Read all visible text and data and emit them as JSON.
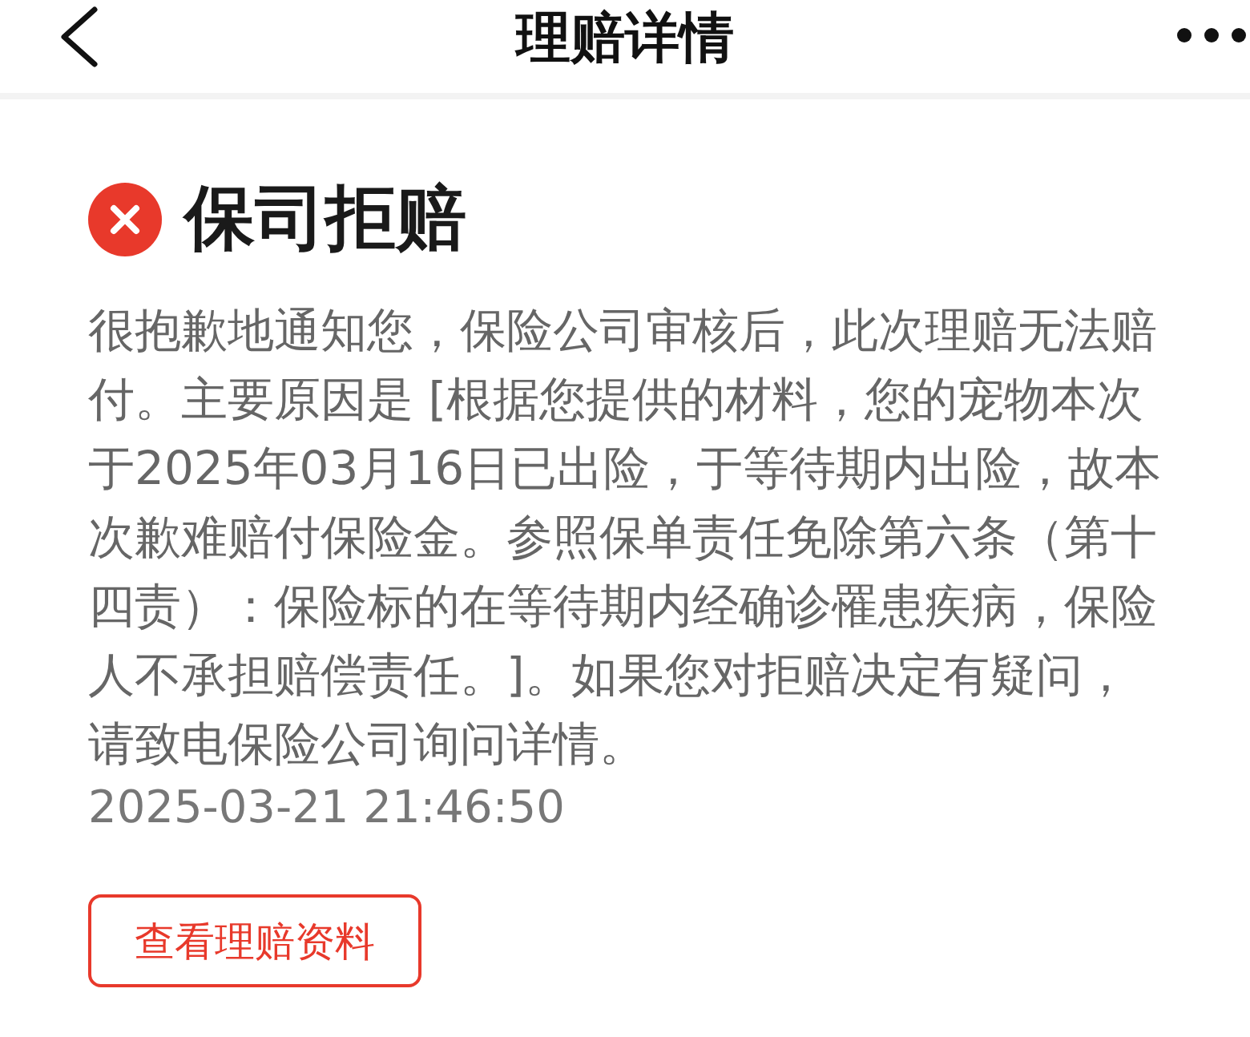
{
  "header": {
    "title": "理赔详情"
  },
  "result": {
    "rejected": true,
    "title": "保司拒赔",
    "message": "很抱歉地通知您，保险公司审核后，此次理赔无法赔付。主要原因是 [根据您提供的材料，您的宠物本次于2025年03月16日已出险，于等待期内出险，故本次歉难赔付保险金。参照保单责任免除第六条（第十四责）：保险标的在等待期内经确诊罹患疾病，保险人不承担赔偿责任。]。如果您对拒赔决定有疑问，请致电保险公司询问详情。",
    "time": "2025-03-21 21:46:50"
  },
  "buttons": [
    {
      "label": "查看理赔资料"
    }
  ]
}
